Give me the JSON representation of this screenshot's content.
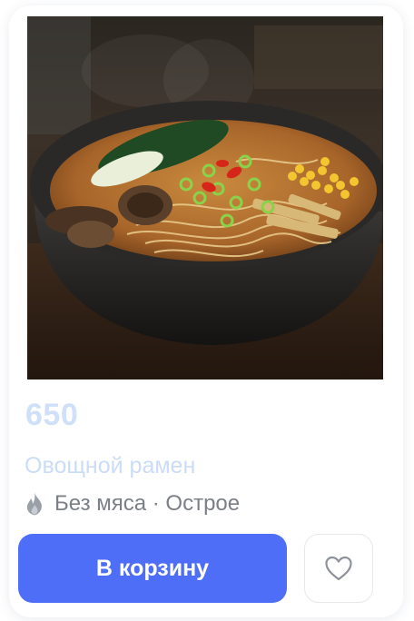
{
  "product": {
    "price": "650",
    "title": "Овощной рамен",
    "tags_text": "Без мяса · Острое",
    "tag_icon": "flame-icon",
    "photo_alt": "Овощной рамен"
  },
  "actions": {
    "cart_label": "В корзину",
    "favorite_icon": "heart-icon"
  },
  "colors": {
    "accent": "#4f6ef7",
    "price": "#cfe0f8",
    "muted_text": "#7b7f86"
  }
}
